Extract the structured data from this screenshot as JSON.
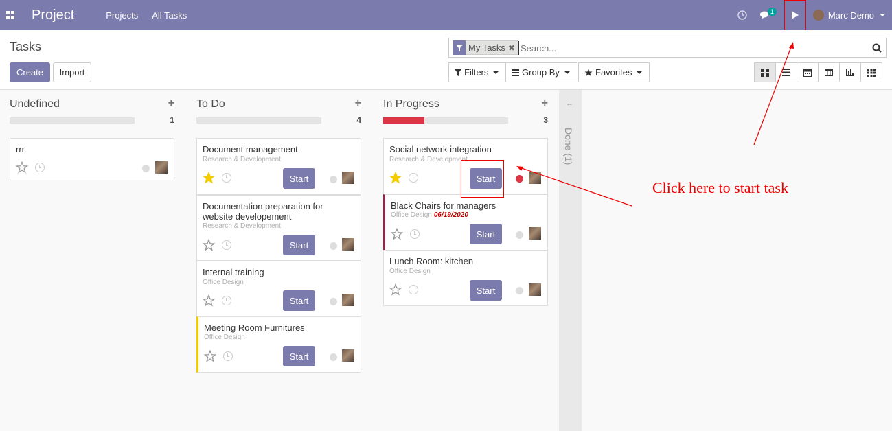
{
  "navbar": {
    "app_name": "Project",
    "menu": [
      "Projects",
      "All Tasks"
    ],
    "chat_badge": "1",
    "user_name": "Marc Demo",
    "icons": [
      "apps-icon",
      "activity-clock-icon",
      "chat-icon",
      "play-icon"
    ]
  },
  "control": {
    "breadcrumb": "Tasks",
    "create_label": "Create",
    "import_label": "Import",
    "search": {
      "facet": "My Tasks",
      "placeholder": "Search..."
    },
    "filters_label": "Filters",
    "group_by_label": "Group By",
    "favorites_label": "Favorites",
    "views": [
      "kanban",
      "list",
      "calendar",
      "pivot",
      "graph",
      "grid"
    ]
  },
  "colors": {
    "brand": "#7c7bad",
    "danger": "#dc3545",
    "annotation": "#ee0000"
  },
  "columns": [
    {
      "title": "Undefined",
      "count": "1",
      "progress_red": 0,
      "cards": [
        {
          "title": "rrr",
          "sub": "",
          "date": "",
          "starred": false,
          "start": false,
          "state": "grey"
        }
      ]
    },
    {
      "title": "To Do",
      "count": "4",
      "progress_red": 0,
      "cards": [
        {
          "title": "Document management",
          "sub": "Research & Development",
          "date": "",
          "starred": true,
          "start": true,
          "state": "grey"
        },
        {
          "title": "Documentation preparation for website developement",
          "sub": "Research & Development",
          "date": "",
          "starred": false,
          "start": true,
          "state": "grey"
        },
        {
          "title": "Internal training",
          "sub": "Office Design",
          "date": "",
          "starred": false,
          "start": true,
          "state": "grey"
        },
        {
          "title": "Meeting Room Furnitures",
          "sub": "Office Design",
          "date": "",
          "starred": false,
          "start": true,
          "state": "grey"
        }
      ]
    },
    {
      "title": "In Progress",
      "count": "3",
      "progress_red": 0.33,
      "cards": [
        {
          "title": "Social network integration",
          "sub": "Research & Development",
          "date": "",
          "starred": true,
          "start": true,
          "state": "red"
        },
        {
          "title": "Black Chairs for managers",
          "sub": "Office Design",
          "date": "06/19/2020",
          "starred": false,
          "start": true,
          "state": "grey"
        },
        {
          "title": "Lunch Room: kitchen",
          "sub": "Office Design",
          "date": "",
          "starred": false,
          "start": true,
          "state": "grey"
        }
      ]
    }
  ],
  "done_column": {
    "label": "Done (1)"
  },
  "start_label": "Start",
  "annotation": {
    "text": "Click here to start task"
  }
}
